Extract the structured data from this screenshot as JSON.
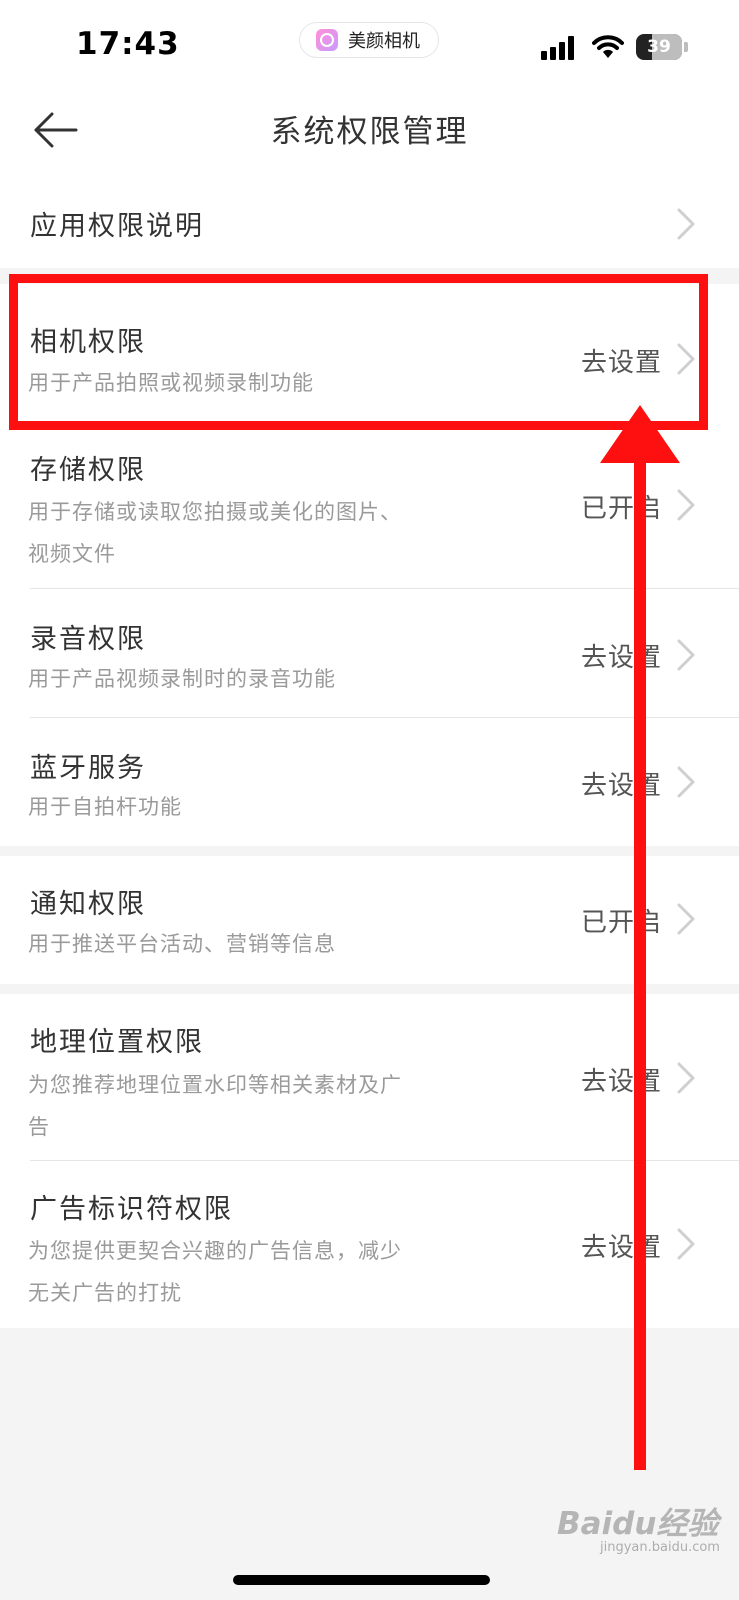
{
  "status_bar": {
    "time": "17:43",
    "app_name": "美颜相机",
    "battery": "39"
  },
  "nav": {
    "title": "系统权限管理",
    "back_icon": "arrow-left-icon"
  },
  "intro_row": {
    "label": "应用权限说明"
  },
  "permissions": [
    {
      "title": "相机权限",
      "desc": "用于产品拍照或视频录制功能",
      "status": "去设置"
    },
    {
      "title": "存储权限",
      "desc": "用于存储或读取您拍摄或美化的图片、视频文件",
      "status": "已开启"
    },
    {
      "title": "录音权限",
      "desc": "用于产品视频录制时的录音功能",
      "status": "去设置"
    },
    {
      "title": "蓝牙服务",
      "desc": "用于自拍杆功能",
      "status": "去设置"
    },
    {
      "title": "通知权限",
      "desc": "用于推送平台活动、营销等信息",
      "status": "已开启"
    },
    {
      "title": "地理位置权限",
      "desc": "为您推荐地理位置水印等相关素材及广告",
      "status": "去设置"
    },
    {
      "title": "广告标识符权限",
      "desc": "为您提供更契合兴趣的广告信息，减少无关广告的打扰",
      "status": "去设置"
    }
  ],
  "annotation": {
    "color": "#ff1010"
  },
  "watermark": {
    "brand": "Baidu经验",
    "url": "jingyan.baidu.com"
  }
}
